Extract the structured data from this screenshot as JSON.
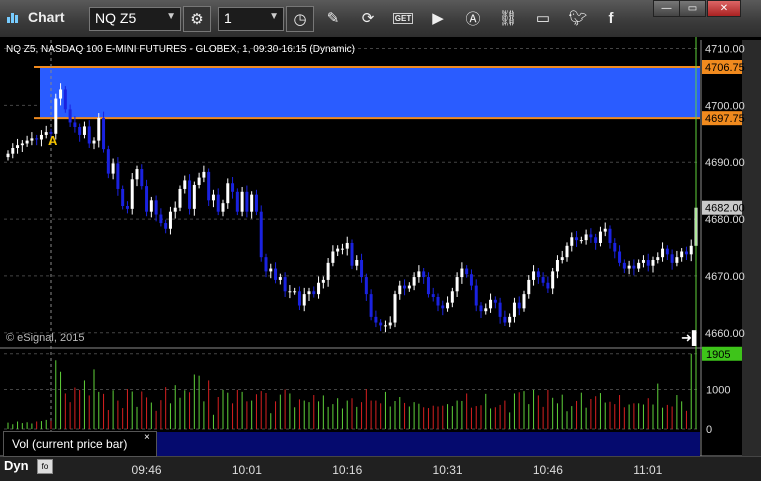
{
  "toolbar": {
    "title": "Chart",
    "symbol": "NQ Z5",
    "interval": "1",
    "buttons": [
      "pencil-icon",
      "refresh-icon",
      "get-icon",
      "play-icon",
      "alert-icon",
      "link-icon",
      "comment-icon",
      "twitter-icon",
      "facebook-icon"
    ]
  },
  "window_controls": [
    "minimize",
    "maximize",
    "close"
  ],
  "legend": "NQ Z5, NASDAQ 100 E-MINI FUTURES - GLOBEX, 1, 09:30-16:15 (Dynamic)",
  "section_marker": "A",
  "watermark": "© eSignal, 2015",
  "volume_label": "Vol (current price bar)",
  "volume_close": "×",
  "mode": "Dyn",
  "mode_icon": "fo",
  "colors": {
    "up": "#ffffff",
    "down": "#1a22e0",
    "zone": "#2a5cff",
    "zone_line": "#f08a1e",
    "vol_up": "#5fd23a",
    "vol_down": "#d92020",
    "last_price_tag": "#c8c8c8",
    "vol_tag": "#3ec41a"
  },
  "chart_data": {
    "type": "candlestick",
    "x_ticks": [
      "09:46",
      "10:01",
      "10:16",
      "10:31",
      "10:46",
      "11:01"
    ],
    "x_tick_index": [
      29,
      50,
      71,
      92,
      113,
      134
    ],
    "y_ticks": [
      4660.0,
      4670.0,
      4680.0,
      4690.0,
      4700.0,
      4710.0
    ],
    "y_range": [
      4657.5,
      4711.5
    ],
    "zone": {
      "top": 4706.75,
      "bottom": 4697.75
    },
    "last_price": 4682.0,
    "close": [
      4691.5,
      4692.5,
      4693.0,
      4693.3,
      4693.8,
      4694.2,
      4694.0,
      4694.8,
      4695.3,
      4695.0,
      4701.2,
      4702.8,
      4699.3,
      4697.0,
      4696.2,
      4694.8,
      4696.3,
      4693.3,
      4693.8,
      4697.8,
      4692.3,
      4688.0,
      4689.8,
      4685.3,
      4682.3,
      4681.8,
      4687.0,
      4688.8,
      4685.8,
      4681.3,
      4683.3,
      4680.8,
      4679.3,
      4678.3,
      4681.3,
      4682.0,
      4685.3,
      4686.8,
      4681.8,
      4686.0,
      4687.3,
      4688.3,
      4683.3,
      4684.3,
      4681.3,
      4682.8,
      4686.3,
      4684.8,
      4681.3,
      4684.8,
      4681.3,
      4684.3,
      4681.3,
      4673.3,
      4670.8,
      4671.3,
      4669.3,
      4669.8,
      4667.3,
      4667.3,
      4667.3,
      4664.8,
      4666.8,
      4667.3,
      4666.8,
      4668.8,
      4669.3,
      4672.3,
      4674.3,
      4674.8,
      4674.8,
      4675.8,
      4671.8,
      4672.8,
      4669.8,
      4666.8,
      4662.8,
      4661.8,
      4661.3,
      4661.3,
      4661.8,
      4666.8,
      4668.3,
      4667.8,
      4668.3,
      4669.8,
      4670.8,
      4669.8,
      4666.8,
      4666.3,
      4664.8,
      4664.3,
      4665.3,
      4667.3,
      4669.8,
      4671.3,
      4670.3,
      4668.3,
      4664.8,
      4663.8,
      4664.3,
      4665.8,
      4665.3,
      4662.8,
      4661.8,
      4662.8,
      4665.3,
      4664.3,
      4666.8,
      4669.3,
      4670.8,
      4669.8,
      4668.8,
      4667.8,
      4670.8,
      4672.8,
      4673.3,
      4675.3,
      4676.8,
      4676.3,
      4676.3,
      4677.3,
      4676.8,
      4675.8,
      4677.8,
      4678.3,
      4675.8,
      4674.3,
      4672.3,
      4671.3,
      4671.8,
      4671.3,
      4672.3,
      4672.8,
      4671.8,
      4672.8,
      4673.3,
      4674.8,
      4673.8,
      4672.3,
      4673.3,
      4674.3,
      4673.8,
      4675.3,
      4682.0
    ],
    "volume": [
      160,
      120,
      190,
      150,
      170,
      140,
      190,
      200,
      230,
      210,
      1740,
      1450,
      900,
      680,
      1050,
      990,
      1230,
      850,
      1510,
      940,
      890,
      480,
      980,
      720,
      530,
      1010,
      950,
      560,
      950,
      800,
      670,
      460,
      730,
      1060,
      650,
      1110,
      790,
      980,
      930,
      1380,
      1350,
      700,
      1230,
      360,
      810,
      990,
      920,
      650,
      990,
      940,
      700,
      720,
      880,
      960,
      910,
      400,
      700,
      870,
      1000,
      900,
      550,
      750,
      720,
      680,
      860,
      700,
      850,
      560,
      630,
      780,
      520,
      720,
      780,
      560,
      680,
      1010,
      720,
      720,
      650,
      940,
      570,
      710,
      810,
      660,
      570,
      680,
      640,
      550,
      530,
      590,
      570,
      590,
      630,
      580,
      720,
      710,
      900,
      540,
      580,
      600,
      890,
      520,
      550,
      610,
      720,
      420,
      900,
      930,
      960,
      630,
      990,
      850,
      560,
      990,
      790,
      650,
      870,
      450,
      580,
      710,
      920,
      540,
      760,
      830,
      910,
      670,
      690,
      630,
      860,
      550,
      620,
      650,
      650,
      620,
      780,
      620,
      1150,
      540,
      610,
      570,
      860,
      700,
      460,
      1905
    ],
    "volume_ticks": [
      0,
      1000
    ],
    "volume_last": 1905
  }
}
